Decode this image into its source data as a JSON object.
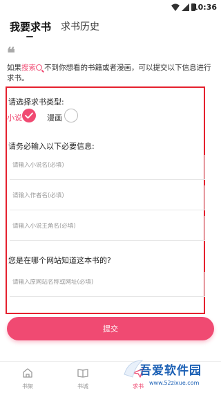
{
  "status_bar": {
    "time": "10:36"
  },
  "tabs": {
    "active": "我要求书",
    "history": "求书历史"
  },
  "intro": {
    "quote_mark": "❝",
    "prefix": "如果",
    "search_word": "搜索",
    "suffix": "不到你想看的书籍或者漫画，可以提交以下信息进行求书。"
  },
  "form": {
    "type_label": "请选择求书类型:",
    "option_novel": "小说",
    "option_comic": "漫画",
    "selected": "小说",
    "info_label": "请务必输入以下必要信息:",
    "novel_name_placeholder": "请输入小说名(必填)",
    "author_placeholder": "请输入作者名(必填)",
    "protagonist_placeholder": "请输入小说主角名(必填)",
    "source_label": "您是在哪个网站知道这本书的?",
    "source_placeholder": "请输入原网站名称或网址(必填)"
  },
  "submit_label": "提交",
  "bottom_nav": {
    "shelf": "书架",
    "store": "书城",
    "request": "求书"
  },
  "watermark": {
    "title": "吾爱软件园",
    "url": "www.52zixue.com"
  }
}
